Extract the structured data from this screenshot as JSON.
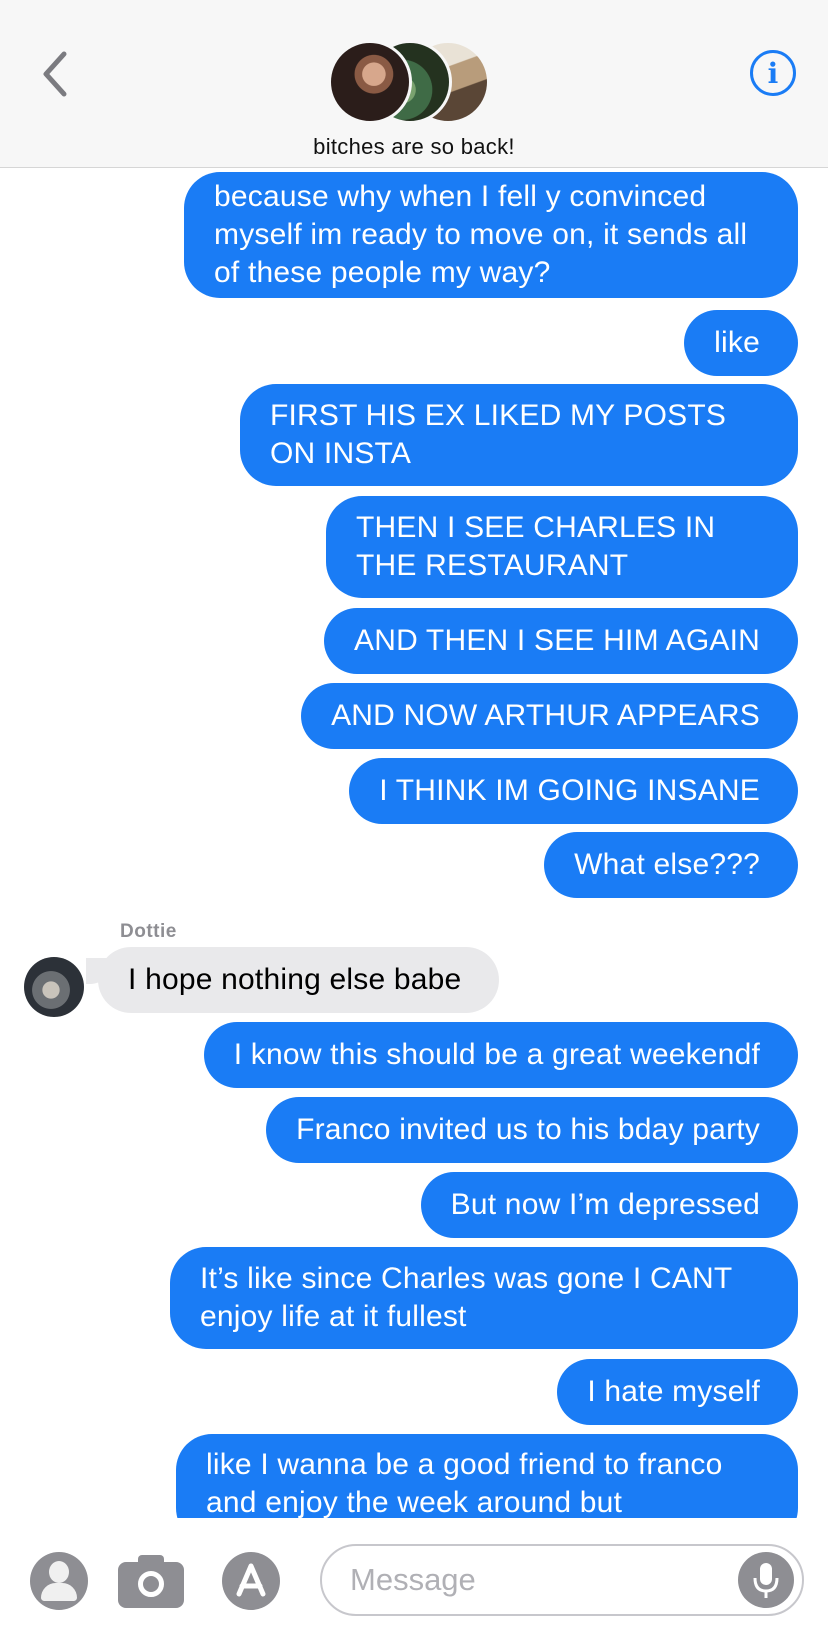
{
  "header": {
    "group_name": "bitches are so back!",
    "back_icon": "chevron-left-icon",
    "info_icon": "info-icon",
    "info_symbol": "i",
    "accent_color": "#1a7cf5"
  },
  "messages": [
    {
      "direction": "outgoing",
      "text": "because why when I fell y convinced myself im ready to move on, it sends all of these people my way?"
    },
    {
      "direction": "outgoing",
      "text": "like"
    },
    {
      "direction": "outgoing",
      "text": "FIRST HIS EX LIKED MY POSTS ON INSTA"
    },
    {
      "direction": "outgoing",
      "text": "THEN I SEE CHARLES IN THE RESTAURANT"
    },
    {
      "direction": "outgoing",
      "text": "AND THEN I SEE HIM AGAIN"
    },
    {
      "direction": "outgoing",
      "text": "AND NOW ARTHUR APPEARS"
    },
    {
      "direction": "outgoing",
      "text": "I THINK IM GOING INSANE"
    },
    {
      "direction": "outgoing",
      "text": "What else???"
    },
    {
      "direction": "incoming",
      "sender": "Dottie",
      "text": "I hope nothing else babe"
    },
    {
      "direction": "outgoing",
      "text": "I know this should be a great weekendf"
    },
    {
      "direction": "outgoing",
      "text": "Franco invited us to his bday party"
    },
    {
      "direction": "outgoing",
      "text": "But now I’m depressed"
    },
    {
      "direction": "outgoing",
      "text": "It’s like since Charles was gone I CANT enjoy life at it fullest"
    },
    {
      "direction": "outgoing",
      "text": "I hate myself"
    },
    {
      "direction": "outgoing",
      "text": "like I wanna be a good friend to franco and enjoy the week around but"
    }
  ],
  "composer": {
    "placeholder": "Message",
    "icons": [
      "contact-icon",
      "camera-icon",
      "app-store-icon",
      "microphone-icon"
    ]
  },
  "colors": {
    "outgoing_bubble": "#1a7cf5",
    "incoming_bubble": "#e9e9eb"
  }
}
